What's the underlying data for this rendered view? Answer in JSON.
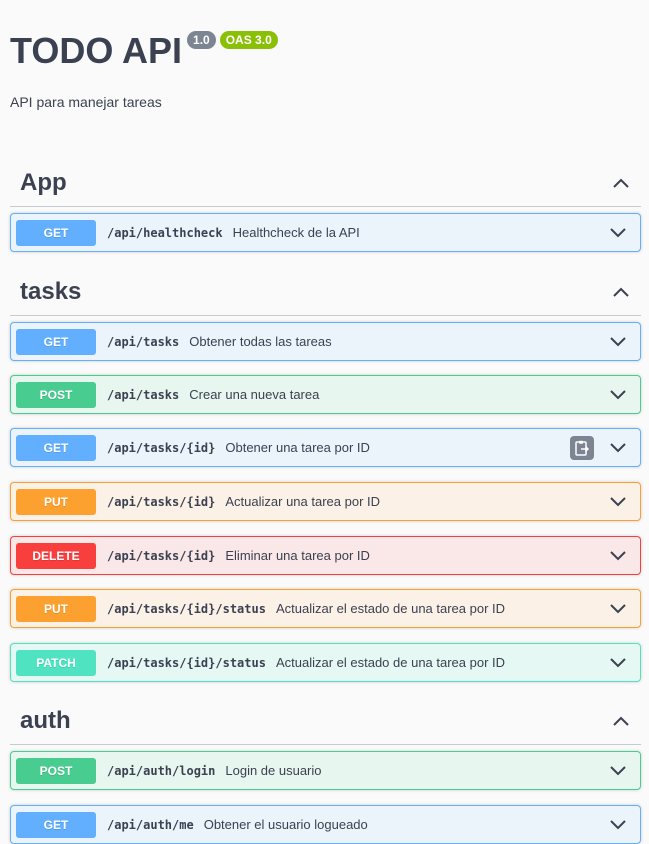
{
  "info": {
    "title": "TODO API",
    "version_badge": "1.0",
    "oas_badge": "OAS 3.0",
    "description": "API para manejar tareas"
  },
  "tags": [
    {
      "name": "App",
      "operations": [
        {
          "method": "GET",
          "path": "/api/healthcheck",
          "summary": "Healthcheck de la API"
        }
      ]
    },
    {
      "name": "tasks",
      "operations": [
        {
          "method": "GET",
          "path": "/api/tasks",
          "summary": "Obtener todas las tareas"
        },
        {
          "method": "POST",
          "path": "/api/tasks",
          "summary": "Crear una nueva tarea"
        },
        {
          "method": "GET",
          "path": "/api/tasks/{id}",
          "summary": "Obtener una tarea por ID"
        },
        {
          "method": "PUT",
          "path": "/api/tasks/{id}",
          "summary": "Actualizar una tarea por ID"
        },
        {
          "method": "DELETE",
          "path": "/api/tasks/{id}",
          "summary": "Eliminar una tarea por ID"
        },
        {
          "method": "PUT",
          "path": "/api/tasks/{id}/status",
          "summary": "Actualizar el estado de una tarea por ID"
        },
        {
          "method": "PATCH",
          "path": "/api/tasks/{id}/status",
          "summary": "Actualizar el estado de una tarea por ID"
        }
      ]
    },
    {
      "name": "auth",
      "operations": [
        {
          "method": "POST",
          "path": "/api/auth/login",
          "summary": "Login de usuario"
        },
        {
          "method": "GET",
          "path": "/api/auth/me",
          "summary": "Obtener el usuario logueado"
        }
      ]
    }
  ],
  "icons": {
    "tag_toggle": "chevron-up-icon",
    "op_expand": "chevron-down-icon",
    "copy": "copy-to-clipboard-icon"
  },
  "colors": {
    "get": "#61affe",
    "post": "#49cc90",
    "put": "#fca130",
    "delete": "#f93e3e",
    "patch": "#50e3c2",
    "version_badge": "#7d8492",
    "oas_badge": "#89bf04"
  }
}
